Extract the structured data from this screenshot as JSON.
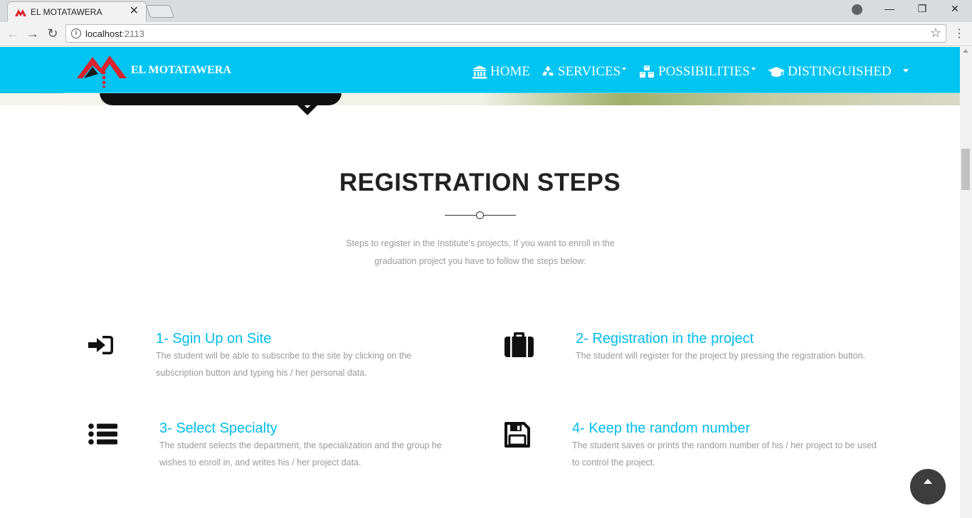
{
  "browser": {
    "tab_title": "EL MOTATAWERA",
    "tab_close": "✕",
    "url_host": "localhost",
    "url_port": ":2113",
    "info_glyph": "i",
    "star_glyph": "☆",
    "back_glyph": "←",
    "forward_glyph": "→",
    "reload_glyph": "↻",
    "menu_glyph": "⋮",
    "minimize_glyph": "—",
    "restore_glyph": "❐",
    "close_glyph": "✕"
  },
  "navbar": {
    "brand": "EL MOTATAWERA",
    "background": "#00c4f2",
    "items": [
      {
        "label": "HOME",
        "icon": "bank-icon"
      },
      {
        "label": "SERVICES",
        "icon": "recycle-icon"
      },
      {
        "label": "POSSIBILITIES",
        "icon": "cubes-icon"
      },
      {
        "label": "DISTINGUISHED",
        "icon": "graduation-cap-icon"
      }
    ]
  },
  "section": {
    "title": "REGISTRATION STEPS",
    "subtitle": "Steps to register in the Institute's projects,  If you want to enroll in the graduation project you have to follow the steps below:",
    "accent": "#00bcea",
    "steps": [
      {
        "title": "1- Sgin Up on Site",
        "text": "The student will be able to subscribe to the site by clicking on the subscription button and typing his / her personal data.",
        "icon": "sign-in-icon"
      },
      {
        "title": "2- Registration in the project",
        "text": "The student will register for the project by pressing the registration button.",
        "icon": "briefcase-icon"
      },
      {
        "title": "3- Select Specialty",
        "text": "The student selects the department, the specialization and the group he wishes to enroll in, and writes his / her project data.",
        "icon": "list-icon"
      },
      {
        "title": "4- Keep the random number",
        "text": "The student saves or prints the random number of his / her project to be used to control the project.",
        "icon": "save-icon"
      }
    ]
  }
}
